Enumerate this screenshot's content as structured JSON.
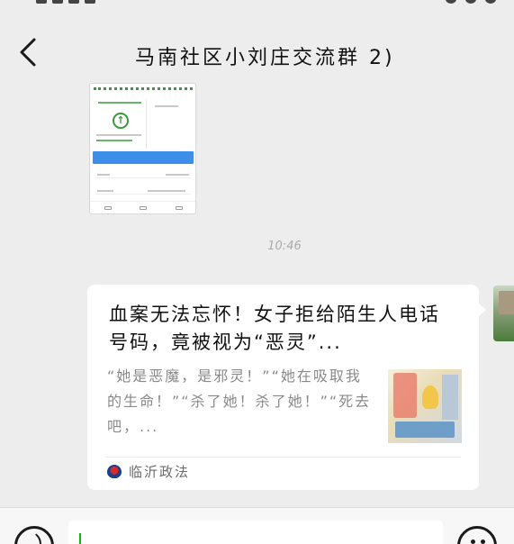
{
  "header": {
    "title": "马南社区小刘庄交流群 2)"
  },
  "chat": {
    "timestamp": "10:46",
    "link_card": {
      "title": "血案无法忘怀！女子拒给陌生人电话号码，竟被视为“恶灵”...",
      "description": "“她是恶魔，是邪灵！”“她在吸取我的生命！”“杀了她！杀了她！”“死去吧，...",
      "source": "临沂政法"
    }
  },
  "icons": {
    "back": "chevron-left-icon",
    "voice": "voice-icon",
    "emoji": "emoji-icon",
    "source_logo": "source-logo-icon"
  },
  "colors": {
    "background": "#ededed",
    "bubble": "#ffffff",
    "caret": "#1aad19"
  }
}
